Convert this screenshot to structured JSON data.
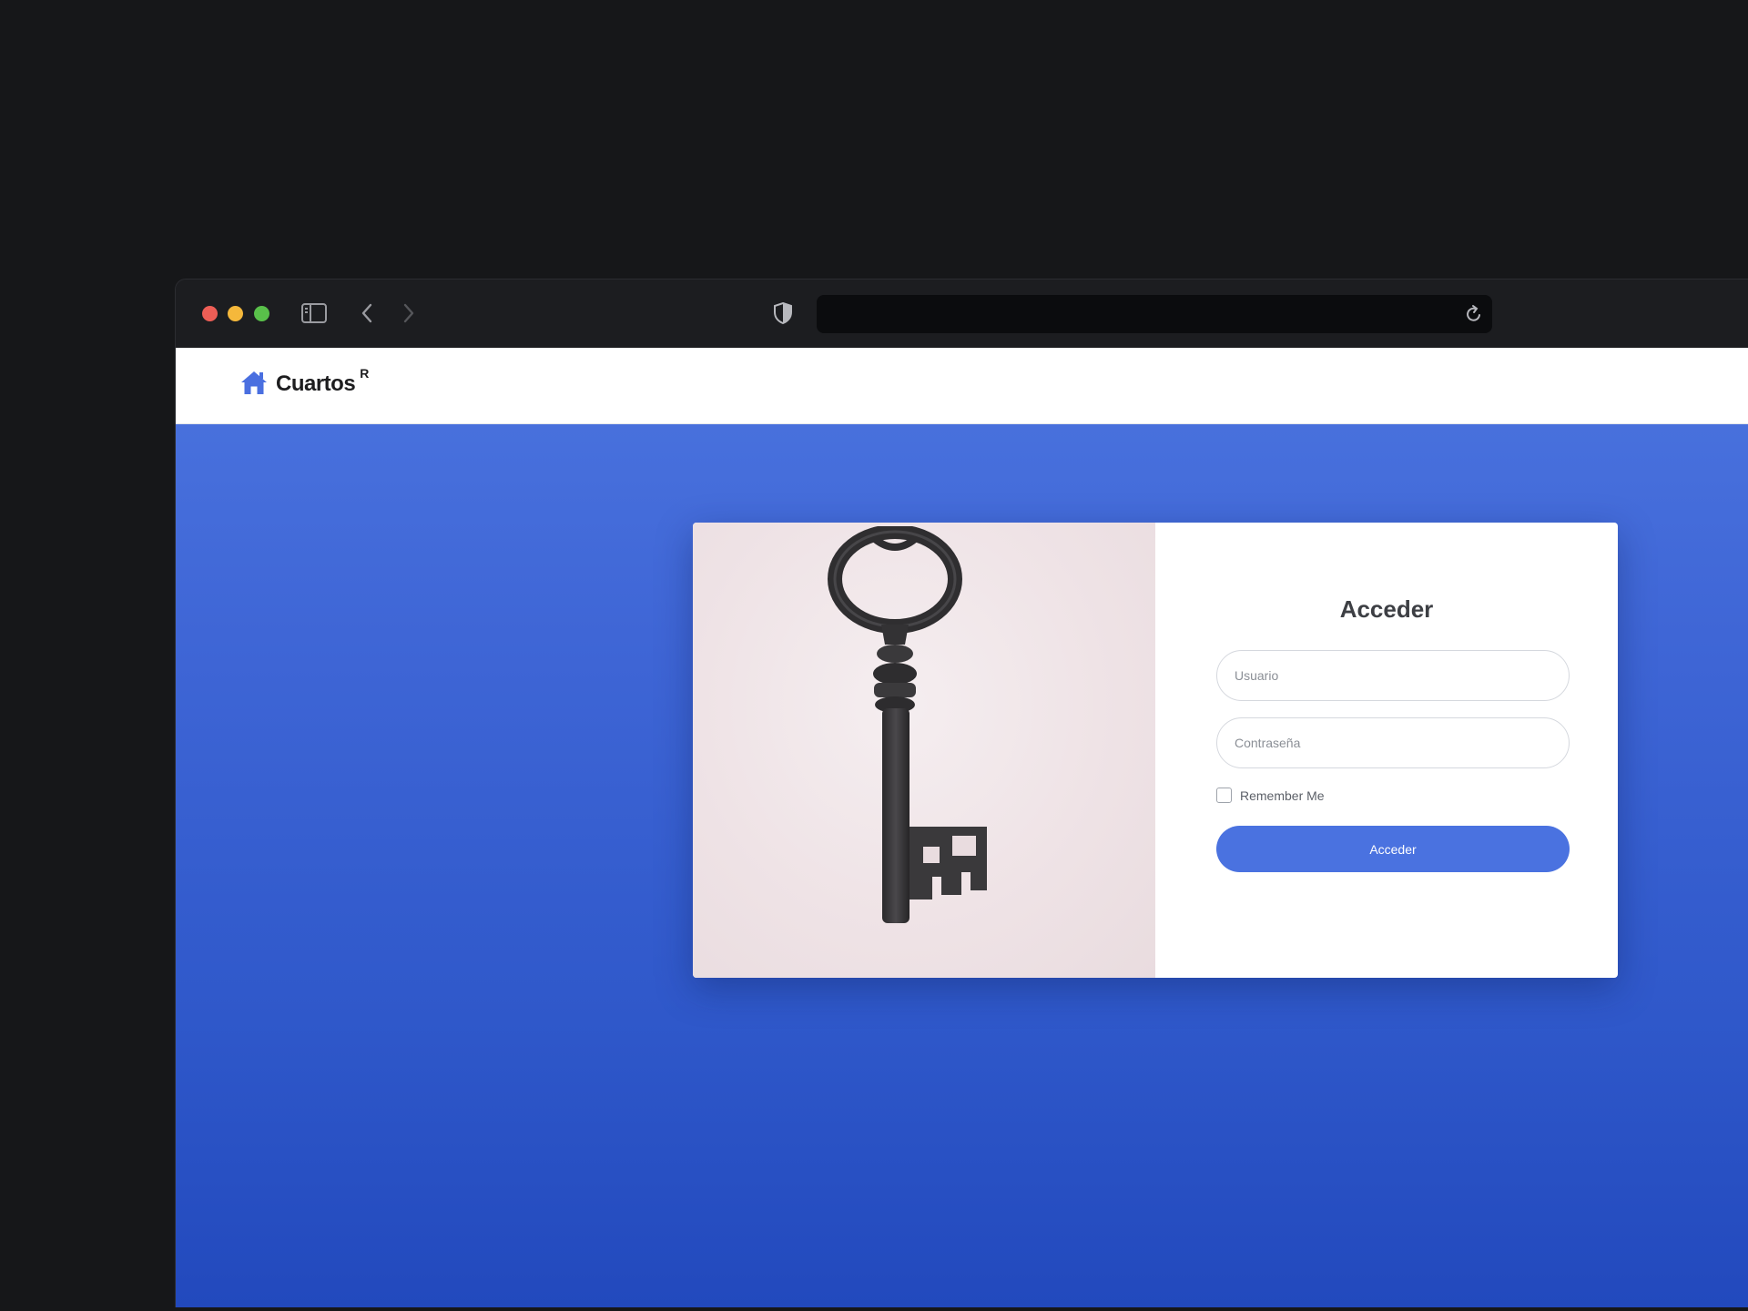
{
  "browser": {
    "window_controls": [
      "close",
      "minimize",
      "maximize"
    ],
    "icons": {
      "sidebar": "sidebar-toggle-icon",
      "back": "chevron-left-icon",
      "forward": "chevron-right-icon",
      "privacy": "shield-icon",
      "reload": "reload-icon"
    },
    "address": ""
  },
  "navbar": {
    "brand_name": "Cuartos",
    "brand_superscript": "R",
    "brand_icon": "home-icon"
  },
  "login": {
    "title": "Acceder",
    "username_placeholder": "Usuario",
    "password_placeholder": "Contraseña",
    "remember_label": "Remember Me",
    "submit_label": "Acceder"
  },
  "colors": {
    "accent": "#4a72e0",
    "background_top": "#4b74df",
    "background_bottom": "#2249bd"
  }
}
